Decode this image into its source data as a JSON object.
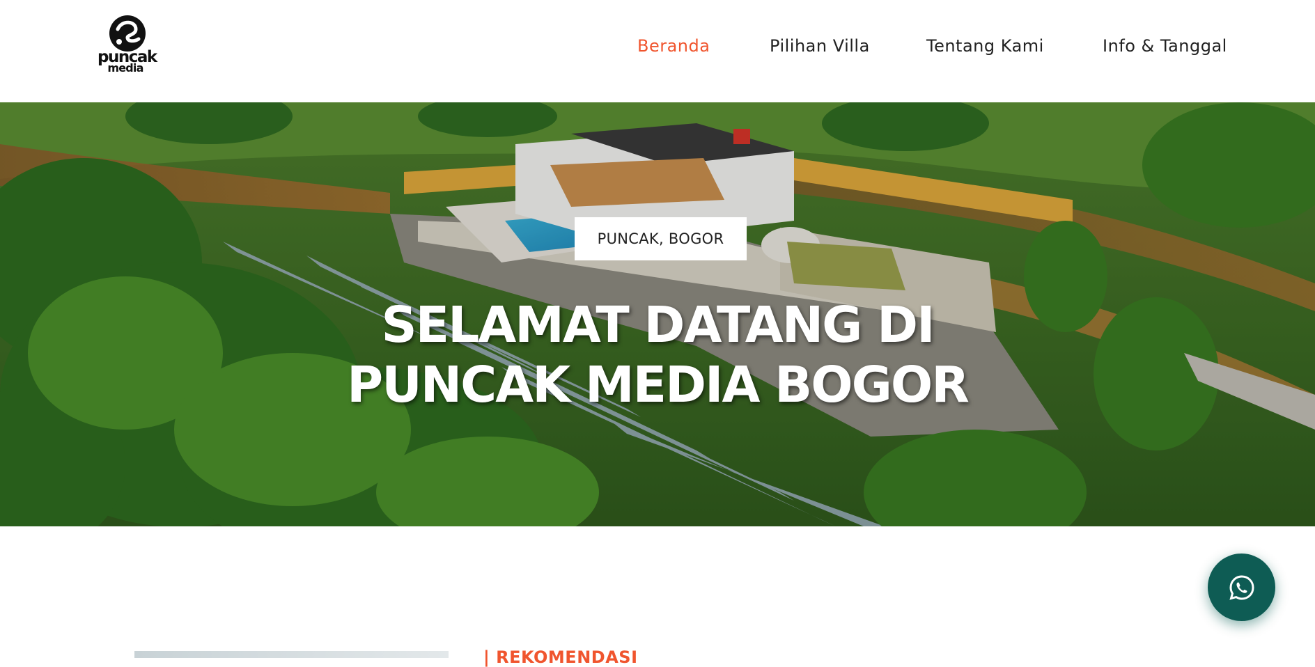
{
  "brand": {
    "logo_word1": "puncak",
    "logo_word2": "media"
  },
  "nav": {
    "items": [
      {
        "label": "Beranda",
        "active": true
      },
      {
        "label": "Pilihan Villa",
        "active": false
      },
      {
        "label": "Tentang Kami",
        "active": false
      },
      {
        "label": "Info & Tanggal",
        "active": false
      }
    ]
  },
  "hero": {
    "location": "PUNCAK, BOGOR",
    "title_line1": "SELAMAT DATANG DI",
    "title_line2": "PUNCAK MEDIA BOGOR"
  },
  "section": {
    "label": "| REKOMENDASI"
  },
  "colors": {
    "accent": "#f0552e",
    "whatsapp": "#0e5c54"
  },
  "icons": {
    "floating_button": "whatsapp-icon"
  }
}
